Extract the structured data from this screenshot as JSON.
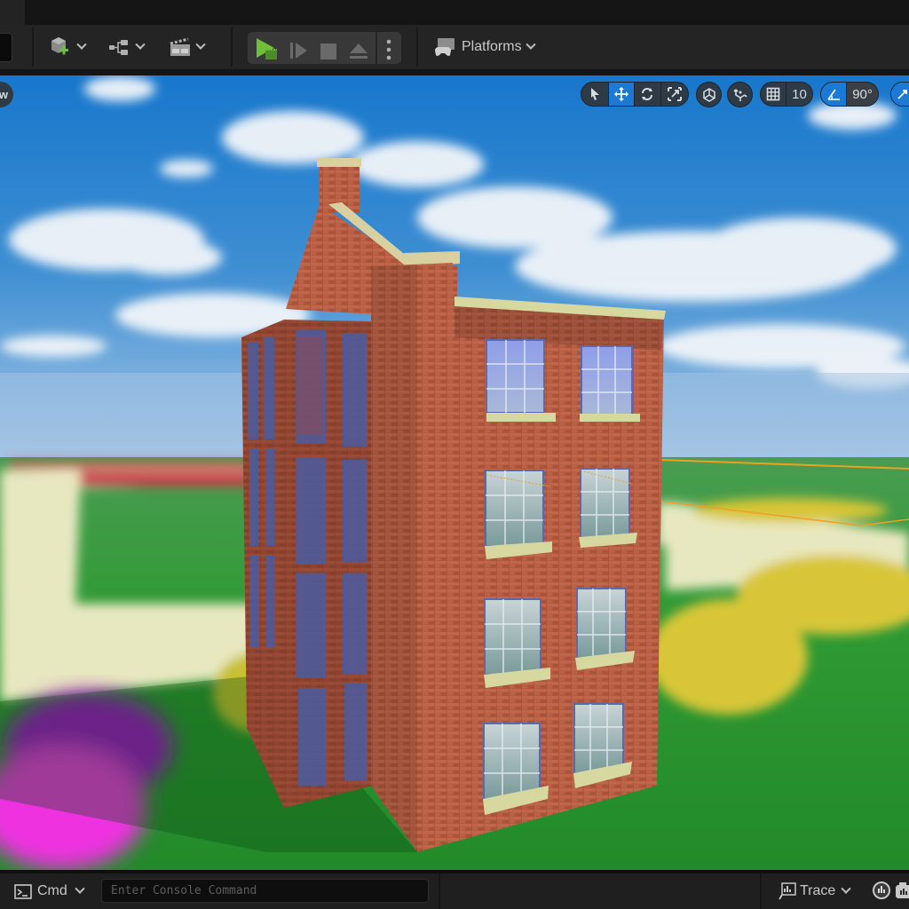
{
  "toolbar": {
    "add_actor": {
      "icon": "add-actor-icon",
      "has_dropdown": true
    },
    "blueprints": {
      "icon": "blueprint-icon",
      "has_dropdown": true
    },
    "cinematics": {
      "icon": "clapperboard-icon",
      "has_dropdown": true
    },
    "play_controls": [
      {
        "name": "play",
        "icon": "play-icon",
        "color": "#6fbf3a"
      },
      {
        "name": "advance-frame",
        "icon": "step-forward-icon"
      },
      {
        "name": "stop",
        "icon": "stop-icon"
      },
      {
        "name": "eject",
        "icon": "eject-icon"
      },
      {
        "name": "more-options",
        "icon": "vertical-ellipsis-icon"
      }
    ],
    "platforms_label": "Platforms"
  },
  "viewport": {
    "left_button_label": "w",
    "transform_tools": [
      {
        "name": "select",
        "icon": "cursor-arrow-icon",
        "active": false
      },
      {
        "name": "translate",
        "icon": "move-arrows-icon",
        "active": true
      },
      {
        "name": "rotate",
        "icon": "rotate-icon",
        "active": false
      },
      {
        "name": "scale",
        "icon": "scale-icon",
        "active": false
      }
    ],
    "coordinate_space_icon": "world-space-icon",
    "surface_snapping_icon": "surface-snap-icon",
    "grid_snap": {
      "icon": "grid-icon",
      "value": "10"
    },
    "rotation_snap": {
      "icon": "angle-icon",
      "value": "90°",
      "active": true
    },
    "scale_snap_icon": "scale-snap-icon",
    "accent_color": "#1a7ad6"
  },
  "statusbar": {
    "cmd_label": "Cmd",
    "console_placeholder": "Enter Console Command",
    "console_value": "",
    "trace_label": "Trace"
  }
}
